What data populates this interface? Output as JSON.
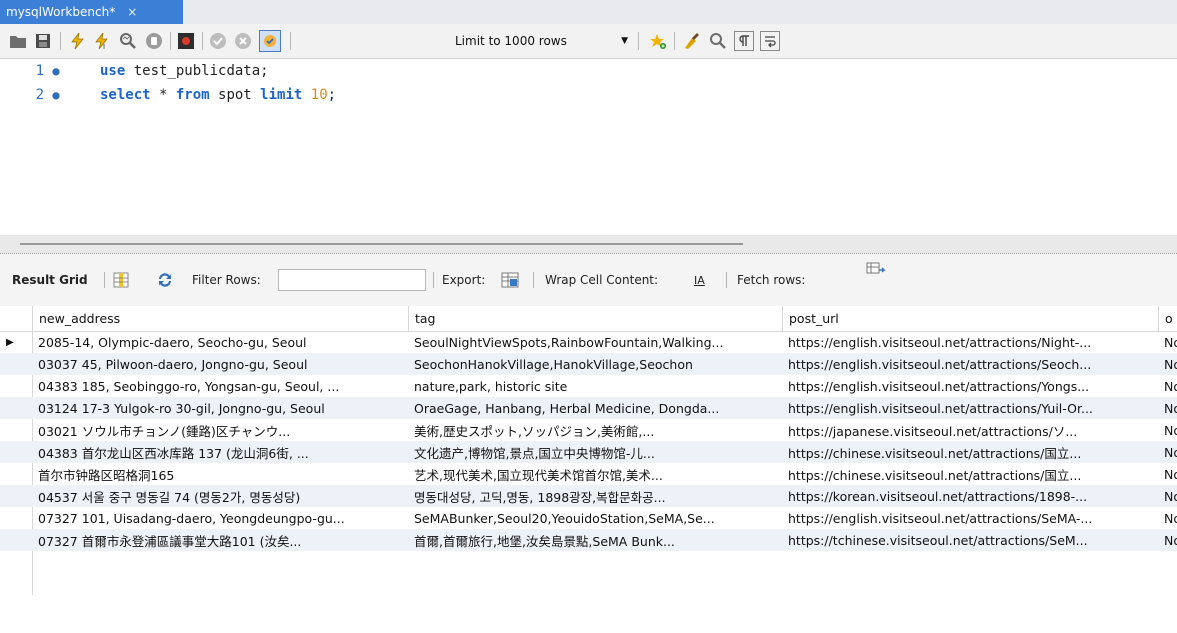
{
  "tab": {
    "title": "mysqlWorkbench*",
    "close": "×"
  },
  "toolbar": {
    "limit_label": "Limit to 1000 rows",
    "accent": "#3c7fd6"
  },
  "editor": {
    "lines": [
      {
        "num": "1",
        "tokens": [
          {
            "t": "use",
            "c": "kw"
          },
          {
            "t": " test_publicdata;",
            "c": "id"
          }
        ]
      },
      {
        "num": "2",
        "tokens": [
          {
            "t": "select",
            "c": "kw"
          },
          {
            "t": " * ",
            "c": "id"
          },
          {
            "t": "from",
            "c": "kw"
          },
          {
            "t": " spot ",
            "c": "id"
          },
          {
            "t": "limit",
            "c": "kw"
          },
          {
            "t": " ",
            "c": "id"
          },
          {
            "t": "10",
            "c": "num"
          },
          {
            "t": ";",
            "c": "id"
          }
        ]
      }
    ]
  },
  "result_toolbar": {
    "result_grid": "Result Grid",
    "filter_rows": "Filter Rows:",
    "export": "Export:",
    "wrap": "Wrap Cell Content:",
    "wrap_icon_text": "IA",
    "fetch": "Fetch rows:"
  },
  "grid": {
    "columns": [
      "new_address",
      "tag",
      "post_url",
      "o"
    ],
    "rows": [
      [
        "2085-14, Olympic-daero, Seocho-gu, Seoul",
        "SeoulNightViewSpots,RainbowFountain,Walking...",
        "https://english.visitseoul.net/attractions/Night-...",
        "No"
      ],
      [
        "03037 45, Pilwoon-daero, Jongno-gu, Seoul",
        "SeochonHanokVillage,HanokVillage,Seochon",
        "https://english.visitseoul.net/attractions/Seoch...",
        "No"
      ],
      [
        "04383 185, Seobinggo-ro, Yongsan-gu, Seoul, ...",
        "nature,park, historic site",
        "https://english.visitseoul.net/attractions/Yongs...",
        "No"
      ],
      [
        "03124 17-3 Yulgok-ro 30-gil, Jongno-gu, Seoul",
        "OraeGage, Hanbang, Herbal Medicine, Dongda...",
        "https://english.visitseoul.net/attractions/Yuil-Or...",
        "No"
      ],
      [
        "03021 ソウル市チョンノ(鍾路)区チャンウ...",
        "美術,歴史スポット,ソッパジョン,美術館,...",
        "https://japanese.visitseoul.net/attractions/ソ...",
        "No"
      ],
      [
        "04383 首尔龙山区西冰库路 137 (龙山洞6街, ...",
        "文化遗产,博物馆,景点,国立中央博物馆-儿...",
        "https://chinese.visitseoul.net/attractions/国立...",
        "No"
      ],
      [
        "首尔市钟路区昭格洞165",
        "艺术,现代美术,国立现代美术馆首尔馆,美术...",
        "https://chinese.visitseoul.net/attractions/国立...",
        "No"
      ],
      [
        "04537 서울 중구 명동길 74 (명동2가, 명동성당)",
        "명동대성당, 고딕,명동, 1898광장,복합문화공...",
        "https://korean.visitseoul.net/attractions/1898-...",
        "No"
      ],
      [
        "07327 101, Uisadang-daero, Yeongdeungpo-gu...",
        "SeMABunker,Seoul20,YeouidoStation,SeMA,Se...",
        "https://english.visitseoul.net/attractions/SeMA-...",
        "No"
      ],
      [
        "07327 首爾市永登浦區議事堂大路101 (汝矣...",
        "首爾,首爾旅行,地堡,汝矣島景點,SeMA Bunk...",
        "https://tchinese.visitseoul.net/attractions/SeM...",
        "No"
      ]
    ],
    "current_row_marker": "▶"
  },
  "icons": [
    "folder-icon",
    "save-icon",
    "execute-icon",
    "execute-current-icon",
    "explain-icon",
    "stop-icon",
    "toggle-output-icon",
    "commit-icon",
    "rollback-icon",
    "autocommit-icon",
    "bookmark-icon",
    "beautify-icon",
    "find-icon",
    "invisibles-icon",
    "wrap-icon",
    "grid-icon",
    "refresh-icon",
    "export-icon",
    "fetch-icon"
  ]
}
